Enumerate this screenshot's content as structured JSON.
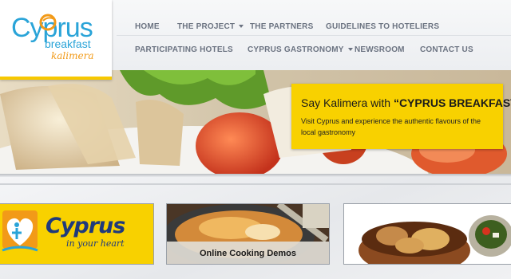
{
  "brand": {
    "logo_name": "Cyprus",
    "logo_line2": "breakfast",
    "logo_line3": "kalimera",
    "colors": {
      "cyan": "#2aa4d8",
      "yellow": "#f8d100",
      "orange": "#f29a18",
      "nav_text": "#6b7381"
    }
  },
  "nav": {
    "row1": [
      {
        "label": "HOME",
        "has_dropdown": false
      },
      {
        "label": "THE PROJECT",
        "has_dropdown": true
      },
      {
        "label": "THE PARTNERS",
        "has_dropdown": false
      },
      {
        "label": "GUIDELINES TO HOTELIERS",
        "has_dropdown": false
      }
    ],
    "row2": [
      {
        "label": "PARTICIPATING HOTELS",
        "has_dropdown": false
      },
      {
        "label": "CYPRUS GASTRONOMY",
        "has_dropdown": true
      },
      {
        "label": "NEWSROOM",
        "has_dropdown": false
      },
      {
        "label": "CONTACT US",
        "has_dropdown": false
      }
    ]
  },
  "hero": {
    "title_prefix": "Say Kalimera with ",
    "title_bold": "“CYPRUS BREAKFAST”",
    "text": "Visit Cyprus and experience the authentic flavours of the local gastronomy"
  },
  "tiles": [
    {
      "title": "Cyprus",
      "subtitle": "in your heart",
      "icon": "cyprus-heart-logo-icon"
    },
    {
      "caption": "Online Cooking Demos",
      "icon": "cooking-photo"
    },
    {
      "caption": "",
      "icon": "food-dish-photo"
    }
  ]
}
